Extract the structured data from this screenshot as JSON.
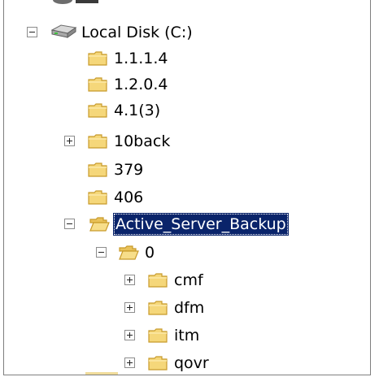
{
  "tree": {
    "drive": {
      "label": "Local Disk (C:)",
      "icon": "hard-drive-icon",
      "expanded": true
    },
    "items": [
      {
        "label": "1.1.1.4",
        "icon": "folder-icon",
        "expander": "none"
      },
      {
        "label": "1.2.0.4",
        "icon": "folder-icon",
        "expander": "none"
      },
      {
        "label": "4.1(3)",
        "icon": "folder-icon",
        "expander": "none"
      },
      {
        "label": "10back",
        "icon": "folder-icon",
        "expander": "plus"
      },
      {
        "label": "379",
        "icon": "folder-icon",
        "expander": "none"
      },
      {
        "label": "406",
        "icon": "folder-icon",
        "expander": "none"
      },
      {
        "label": "Active_Server_Backup",
        "icon": "folder-open-icon",
        "expander": "minus",
        "selected": true
      },
      {
        "label": "0",
        "icon": "folder-open-icon",
        "expander": "minus"
      },
      {
        "label": "cmf",
        "icon": "folder-icon",
        "expander": "plus"
      },
      {
        "label": "dfm",
        "icon": "folder-icon",
        "expander": "plus"
      },
      {
        "label": "itm",
        "icon": "folder-icon",
        "expander": "plus"
      },
      {
        "label": "qovr",
        "icon": "folder-icon",
        "expander": "plus"
      }
    ]
  },
  "colors": {
    "selection_bg": "#0a246a",
    "selection_fg": "#ffffff",
    "folder_fill": "#f5d77a",
    "folder_stroke": "#c89a2a"
  }
}
